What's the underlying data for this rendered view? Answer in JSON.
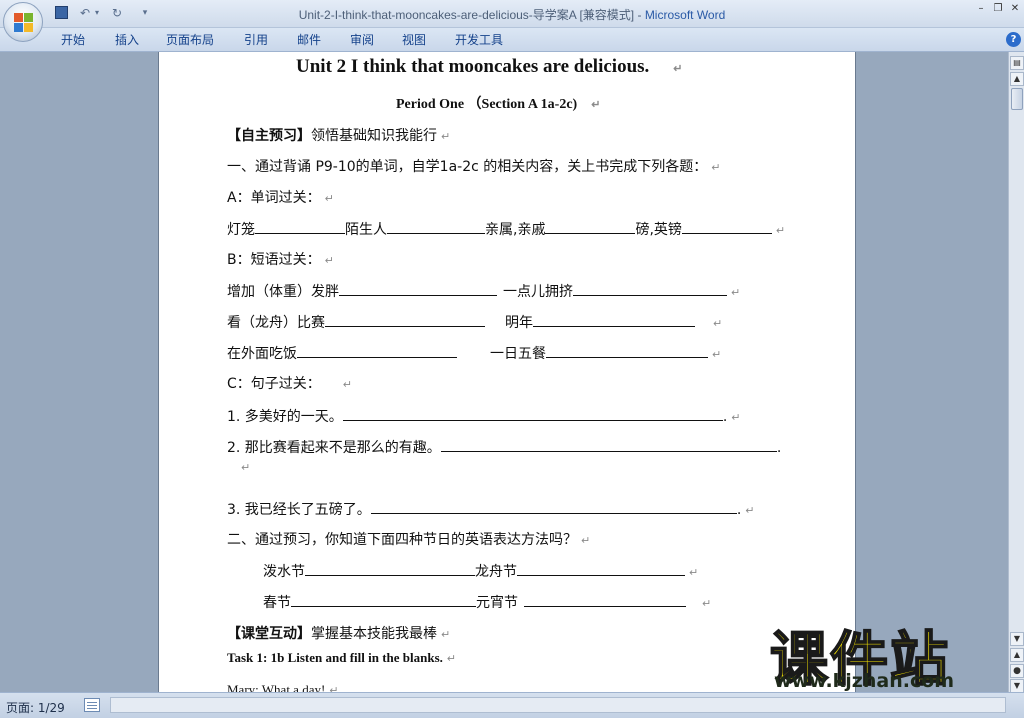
{
  "window": {
    "title": "Unit-2-I-think-that-mooncakes-are-delicious-导学案A [兼容模式]",
    "separator": " - ",
    "app_name": "Microsoft Word"
  },
  "ribbon_tabs": [
    "开始",
    "插入",
    "页面布局",
    "引用",
    "邮件",
    "审阅",
    "视图",
    "开发工具"
  ],
  "document": {
    "title": "Unit 2 I think  that mooncakes  are delicious.",
    "period": "Period One      （Section A 1a-2c)",
    "para_mark": "↵",
    "preview_head_bracket": "【自主预习】",
    "preview_head_text": "领悟基础知识我能行",
    "task1_intro": "一、通过背诵 P9-10的单词，自学1a-2c 的相关内容，关上书完成下列各题：",
    "a_head": "A：单词过关：",
    "vocab": [
      "灯笼",
      "陌生人",
      "亲属,亲戚",
      "磅,英镑"
    ],
    "b_head": "B：短语过关：",
    "phrase_row1": [
      "增加（体重）发胖",
      "一点儿拥挤"
    ],
    "phrase_row2": [
      "看（龙舟）比赛",
      "明年"
    ],
    "phrase_row3": [
      "在外面吃饭",
      "一日五餐"
    ],
    "c_head": "C：句子过关：",
    "s1": "1. 多美好的一天。",
    "s1_end": ".",
    "s2": "2.  那比赛看起来不是那么的有趣。",
    "s2_end": ".",
    "s3": "3. 我已经长了五磅了。",
    "s3_end": ".",
    "task2_intro": "二、通过预习，你知道下面四种节日的英语表达方法吗？",
    "fest_row1": [
      "泼水节",
      "龙舟节"
    ],
    "fest_row2": [
      "春节",
      "元宵节"
    ],
    "class_head_bracket": "【课堂互动】",
    "class_head_text": "掌握基本技能我最棒",
    "task_line": "Task 1: 1b      Listen and fill in the blanks.",
    "dialog_cut": "Mary:    What a                  day!"
  },
  "status": {
    "page": "页面: 1/29"
  },
  "watermark": {
    "cn": "课件站",
    "url": "www.kjzhan.com"
  }
}
